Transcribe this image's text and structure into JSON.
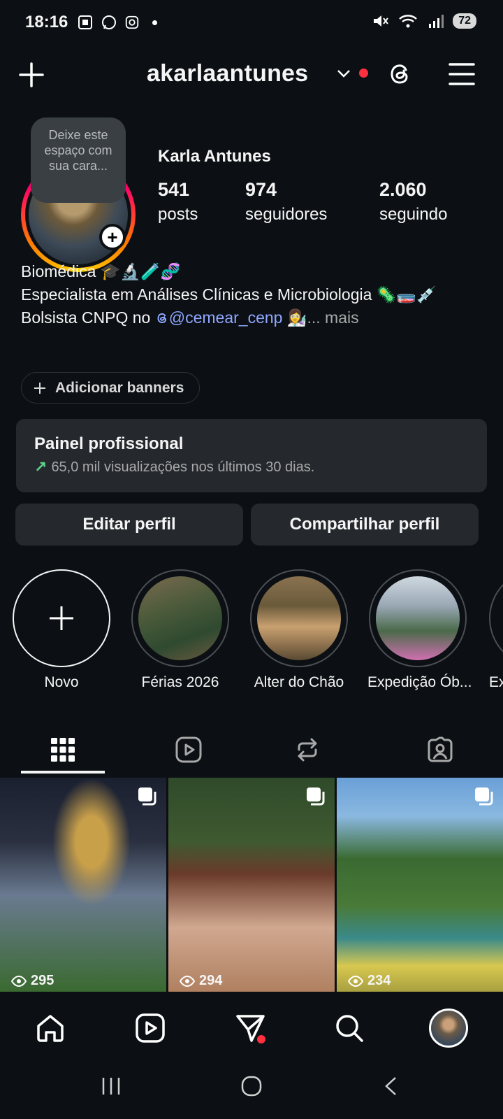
{
  "status_bar": {
    "time": "18:16",
    "battery": "72"
  },
  "header": {
    "username": "akarlaantunes"
  },
  "profile": {
    "note": "Deixe este espaço com sua cara...",
    "display_name": "Karla Antunes",
    "stats": [
      {
        "value": "541",
        "label": "posts"
      },
      {
        "value": "974",
        "label": "seguidores"
      },
      {
        "value": "2.060",
        "label": "seguindo"
      }
    ],
    "bio_line1": "Biomédica 🎓🔬🧪🧬",
    "bio_line2": "Especialista em Análises Clínicas e Microbiologia 🦠🧫💉",
    "bio_line3_prefix": "Bolsista CNPQ no ",
    "bio_mention": "@cemear_cenp",
    "bio_line3_suffix": " 👩‍🔬",
    "bio_more": "... mais"
  },
  "banner_button": "Adicionar banners",
  "pro_panel": {
    "title": "Painel profissional",
    "subtitle": "65,0 mil visualizações nos últimos 30 dias."
  },
  "actions": {
    "edit": "Editar perfil",
    "share": "Compartilhar perfil"
  },
  "highlights": [
    {
      "label": "Novo"
    },
    {
      "label": "Férias 2026"
    },
    {
      "label": "Alter do Chão"
    },
    {
      "label": "Expedição Ób..."
    },
    {
      "label": "Ex"
    }
  ],
  "grid": [
    {
      "views": "295"
    },
    {
      "views": "294"
    },
    {
      "views": "234"
    }
  ],
  "colors": {
    "background": "#0c1014",
    "card": "#25292e",
    "accent_link": "#8fa7ff",
    "notification": "#ff3040"
  }
}
